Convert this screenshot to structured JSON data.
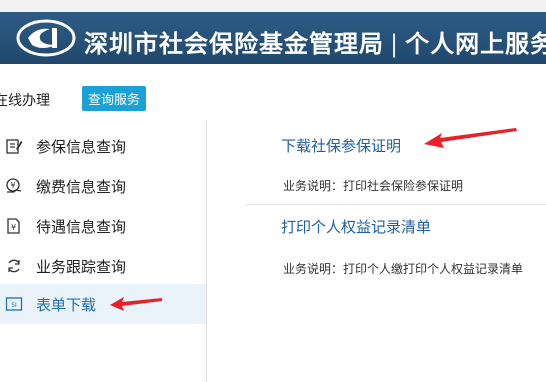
{
  "app": {
    "title": "深圳市社会保险基金管理局",
    "subtitle": "个人网上服务",
    "separator": "|"
  },
  "navbar": {
    "item_online": "在线办理",
    "item_query": "查询服务"
  },
  "sidebar": {
    "items": [
      {
        "label": "参保信息查询",
        "icon": "edit-icon"
      },
      {
        "label": "缴费信息查询",
        "icon": "money-icon"
      },
      {
        "label": "待遇信息查询",
        "icon": "document-icon"
      },
      {
        "label": "业务跟踪查询",
        "icon": "refresh-icon"
      },
      {
        "label": "表单下载",
        "icon": "form-icon",
        "active": true
      }
    ]
  },
  "main": {
    "entries": [
      {
        "title": "下载社保参保证明",
        "desc": "业务说明：打印社会保险参保证明"
      },
      {
        "title": "打印个人权益记录清单",
        "desc": "业务说明：打印个人缴打印个人权益记录清单"
      }
    ]
  },
  "colors": {
    "header_bg": "#2a557e",
    "accent": "#1aa2d8",
    "link": "#1f5fa6",
    "annotation_arrow": "#e8202a"
  }
}
